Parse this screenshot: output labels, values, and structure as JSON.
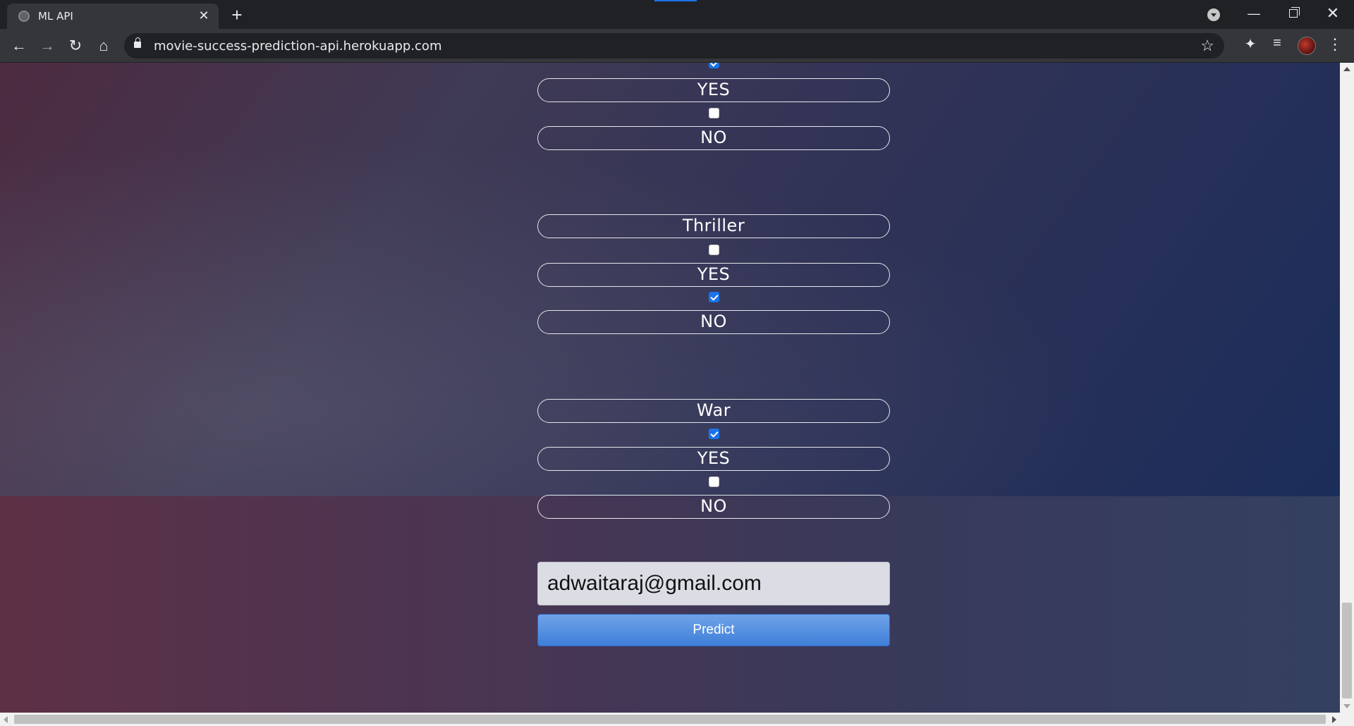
{
  "browser": {
    "tab_title": "ML API",
    "url": "movie-success-prediction-api.herokuapp.com",
    "new_tab_symbol": "+",
    "close_tab_symbol": "✕"
  },
  "form": {
    "groups": [
      {
        "genre": "",
        "yes_label": "YES",
        "no_label": "NO",
        "yes_checked": true,
        "no_checked": false
      },
      {
        "genre": "Thriller",
        "yes_label": "YES",
        "no_label": "NO",
        "yes_checked": false,
        "no_checked": true
      },
      {
        "genre": "War",
        "yes_label": "YES",
        "no_label": "NO",
        "yes_checked": true,
        "no_checked": false
      }
    ],
    "email_value": "adwaitaraj@gmail.com",
    "predict_label": "Predict"
  },
  "colors": {
    "accent": "#1a73e8",
    "button_top": "#6fa3e8",
    "button_bottom": "#3f7fd9"
  }
}
